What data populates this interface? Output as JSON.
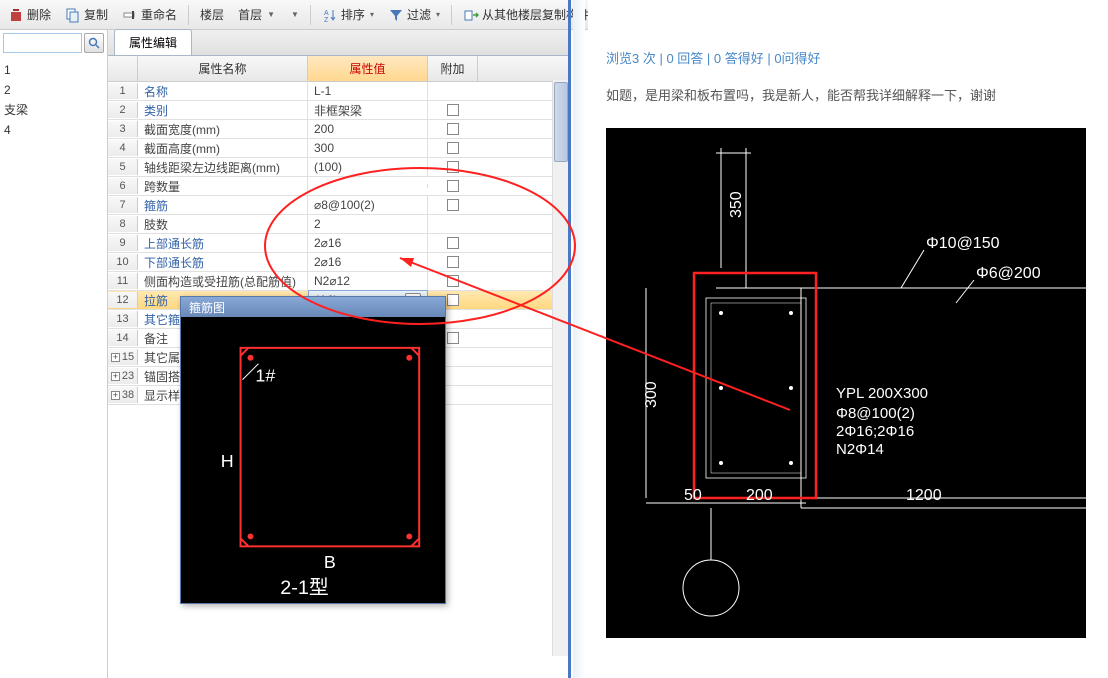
{
  "toolbar": {
    "delete": "删除",
    "copy": "复制",
    "rename": "重命名",
    "floor_label": "楼层",
    "floor_value": "首层",
    "sort": "排序",
    "filter": "过滤",
    "copy_from": "从其他楼层复制构件"
  },
  "search": {
    "placeholder": ""
  },
  "tree": [
    "1",
    "2",
    "支梁",
    "4"
  ],
  "tab": {
    "property_editor": "属性编辑"
  },
  "grid": {
    "headers": {
      "name": "属性名称",
      "value": "属性值",
      "append": "附加"
    },
    "rows": [
      {
        "num": "1",
        "name": "名称",
        "val": "L-1",
        "chk": false,
        "link": true
      },
      {
        "num": "2",
        "name": "类别",
        "val": "非框架梁",
        "chk": true,
        "link": true
      },
      {
        "num": "3",
        "name": "截面宽度(mm)",
        "val": "200",
        "chk": true,
        "link": false
      },
      {
        "num": "4",
        "name": "截面高度(mm)",
        "val": "300",
        "chk": true,
        "link": false
      },
      {
        "num": "5",
        "name": "轴线距梁左边线距离(mm)",
        "val": "(100)",
        "chk": true,
        "link": false
      },
      {
        "num": "6",
        "name": "跨数量",
        "val": "",
        "chk": true,
        "link": false
      },
      {
        "num": "7",
        "name": "箍筋",
        "val": "⌀8@100(2)",
        "chk": true,
        "link": true
      },
      {
        "num": "8",
        "name": "肢数",
        "val": "2",
        "chk": false,
        "link": false
      },
      {
        "num": "9",
        "name": "上部通长筋",
        "val": "2⌀16",
        "chk": true,
        "link": true
      },
      {
        "num": "10",
        "name": "下部通长筋",
        "val": "2⌀16",
        "chk": true,
        "link": true
      },
      {
        "num": "11",
        "name": "侧面构造或受扭筋(总配筋值)",
        "val": "N2⌀12",
        "chk": true,
        "link": false
      },
      {
        "num": "12",
        "name": "拉筋",
        "val": "(A6)",
        "chk": true,
        "link": true,
        "sel": true
      },
      {
        "num": "13",
        "name": "其它箍筋",
        "val": "",
        "chk": false,
        "link": true
      },
      {
        "num": "14",
        "name": "备注",
        "val": "",
        "chk": true,
        "link": false
      },
      {
        "num": "15",
        "name": "其它属性",
        "val": "",
        "chk": false,
        "link": false,
        "gray": true,
        "exp": true
      },
      {
        "num": "23",
        "name": "锚固搭接",
        "val": "",
        "chk": false,
        "link": false,
        "gray": true,
        "exp": true
      },
      {
        "num": "38",
        "name": "显示样式",
        "val": "",
        "chk": false,
        "link": false,
        "gray": true,
        "exp": true
      }
    ]
  },
  "rebar": {
    "title": "箍筋图",
    "label1": "1#",
    "labelH": "H",
    "labelB": "B",
    "type": "2-1型"
  },
  "right": {
    "stats": "浏览3 次 | 0 回答 | 0 答得好 | 0问得好",
    "question": "如题，是用梁和板布置吗，我是新人，能否帮我详细解释一下，谢谢"
  },
  "cad": {
    "dim350": "350",
    "dim300": "300",
    "dim50": "50",
    "dim200": "200",
    "dim1200": "1200",
    "phi10": "Φ10@150",
    "phi6": "Φ6@200",
    "ypl": "YPL 200X300",
    "l1": "Φ8@100(2)",
    "l2": "2Φ16;2Φ16",
    "l3": "N2Φ14"
  }
}
